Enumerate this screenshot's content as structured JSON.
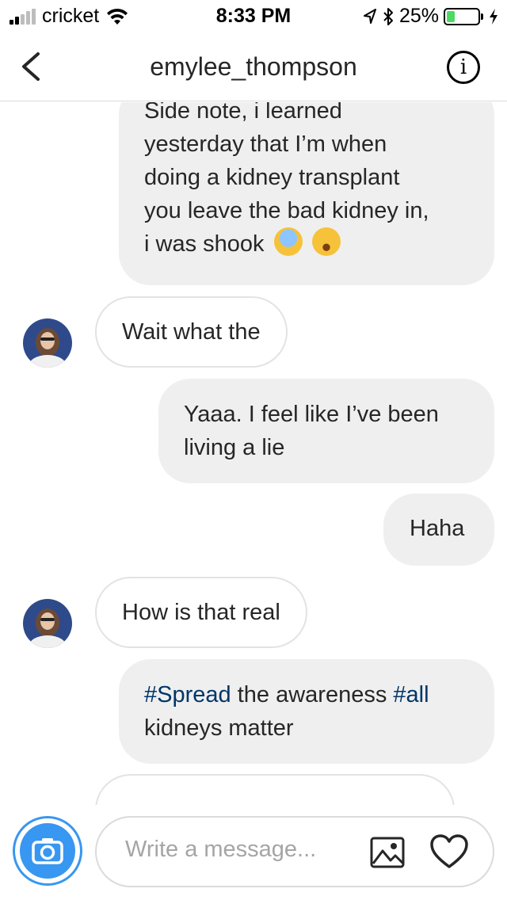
{
  "status_bar": {
    "carrier": "cricket",
    "time": "8:33 PM",
    "battery_percent": "25%",
    "battery_level": 0.25,
    "signal_bars": 2,
    "signal_total": 5
  },
  "header": {
    "title": "emylee_thompson",
    "info_label": "i",
    "icons": [
      "back-chevron-icon",
      "info-icon"
    ]
  },
  "messages": [
    {
      "direction": "outgoing",
      "lines": [
        "Side note, i learned",
        "yesterday that I’m when",
        "doing a kidney transplant",
        "you leave the bad kidney in,",
        "i was shook"
      ],
      "emojis": [
        "screaming-face-emoji",
        "tears-of-joy-emoji"
      ]
    },
    {
      "direction": "incoming",
      "text": "Wait what the"
    },
    {
      "direction": "outgoing",
      "lines": [
        "Yaaa. I feel like I’ve been",
        "living a lie"
      ]
    },
    {
      "direction": "outgoing",
      "text": "Haha"
    },
    {
      "direction": "incoming",
      "text": "How is that real"
    },
    {
      "direction": "outgoing",
      "parts": {
        "tag1": "#Spread",
        "mid": " the awareness ",
        "tag2": "#all",
        "line2": "kidneys matter"
      }
    }
  ],
  "composer": {
    "placeholder": "Write a message...",
    "icons": [
      "camera-icon",
      "gallery-icon",
      "heart-icon"
    ]
  },
  "colors": {
    "accent_blue": "#3897f0",
    "hashtag_blue": "#003569",
    "outgoing_bubble": "#efefef",
    "battery_green": "#4cd964"
  }
}
